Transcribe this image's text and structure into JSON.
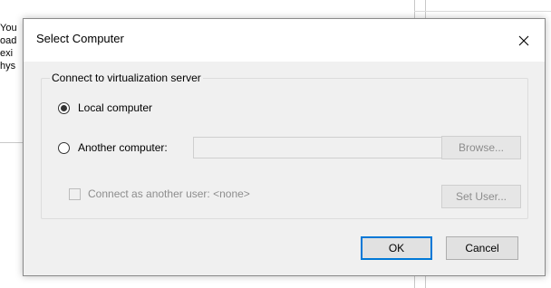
{
  "background_window": {
    "text_fragments": [
      "You",
      "oad",
      "exi",
      "hys"
    ]
  },
  "dialog": {
    "title": "Select Computer",
    "close_icon": "close-icon",
    "group": {
      "legend": "Connect to virtualization server",
      "local_option": {
        "label": "Local computer",
        "checked": true
      },
      "another_option": {
        "label": "Another computer:",
        "checked": false,
        "value": ""
      },
      "browse_label": "Browse...",
      "connect_as_label": "Connect as another user: <none>",
      "set_user_label": "Set User..."
    },
    "ok_label": "OK",
    "cancel_label": "Cancel"
  },
  "colors": {
    "accent": "#0078d7",
    "dialog_bg": "#f0f0f0",
    "disabled_text": "#8d8d8d"
  }
}
